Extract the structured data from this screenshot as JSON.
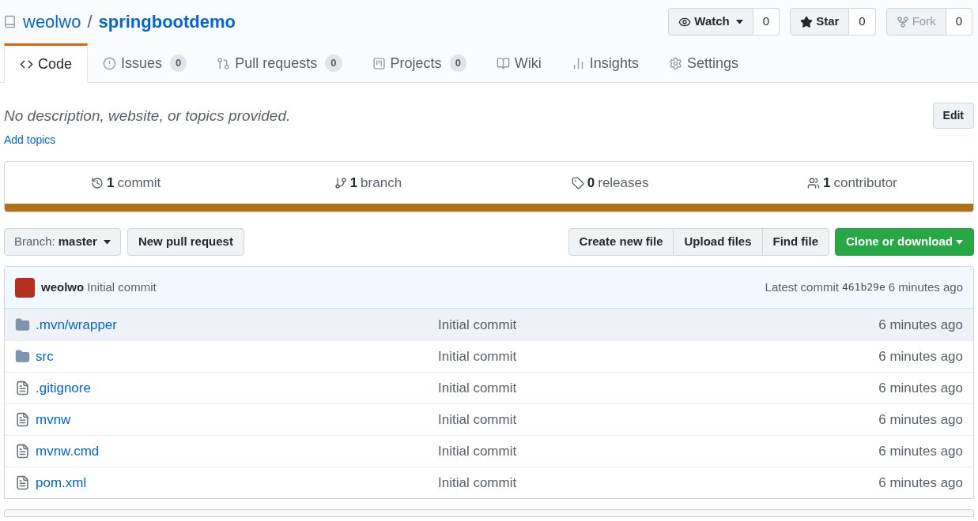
{
  "repo": {
    "owner": "weolwo",
    "separator": "/",
    "name": "springbootdemo"
  },
  "actions": [
    {
      "label": "Watch",
      "count": "0",
      "dropdown": true,
      "disabled": false
    },
    {
      "label": "Star",
      "count": "0",
      "dropdown": false,
      "disabled": false
    },
    {
      "label": "Fork",
      "count": "0",
      "dropdown": false,
      "disabled": true
    }
  ],
  "tabs": [
    {
      "label": "Code",
      "selected": true
    },
    {
      "label": "Issues",
      "count": "0",
      "selected": false
    },
    {
      "label": "Pull requests",
      "count": "0",
      "selected": false
    },
    {
      "label": "Projects",
      "count": "0",
      "selected": false
    },
    {
      "label": "Wiki",
      "selected": false
    },
    {
      "label": "Insights",
      "selected": false
    },
    {
      "label": "Settings",
      "selected": false
    }
  ],
  "description": "No description, website, or topics provided.",
  "edit_button": "Edit",
  "add_topics": "Add topics",
  "stats": [
    {
      "count": "1",
      "label": "commit"
    },
    {
      "count": "1",
      "label": "branch"
    },
    {
      "count": "0",
      "label": "releases"
    },
    {
      "count": "1",
      "label": "contributor"
    }
  ],
  "language_bar": {
    "color": "#b07219"
  },
  "branch_button": {
    "label": "Branch:",
    "value": "master"
  },
  "new_pull_request": "New pull request",
  "file_buttons": [
    "Create new file",
    "Upload files",
    "Find file"
  ],
  "clone_button": "Clone or download",
  "latest_commit": {
    "author": "weolwo",
    "message": "Initial commit",
    "label": "Latest commit",
    "sha": "461b29e",
    "time": "6 minutes ago"
  },
  "files": [
    {
      "kind": "folder",
      "name": ".mvn/wrapper",
      "message": "Initial commit",
      "age": "6 minutes ago",
      "highlighted": true
    },
    {
      "kind": "folder",
      "name": "src",
      "message": "Initial commit",
      "age": "6 minutes ago",
      "highlighted": false
    },
    {
      "kind": "file",
      "name": ".gitignore",
      "message": "Initial commit",
      "age": "6 minutes ago",
      "highlighted": false
    },
    {
      "kind": "file",
      "name": "mvnw",
      "message": "Initial commit",
      "age": "6 minutes ago",
      "highlighted": false
    },
    {
      "kind": "file",
      "name": "mvnw.cmd",
      "message": "Initial commit",
      "age": "6 minutes ago",
      "highlighted": false
    },
    {
      "kind": "file",
      "name": "pom.xml",
      "message": "Initial commit",
      "age": "6 minutes ago",
      "highlighted": false
    }
  ]
}
